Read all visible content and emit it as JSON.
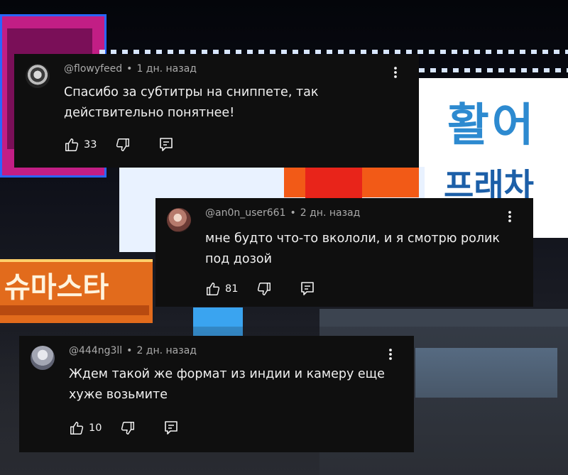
{
  "comments": [
    {
      "author": "@flowyfeed",
      "time": "1 дн. назад",
      "text": "Спасибо за субтитры на сниппете, так действительно понятнее!",
      "likes": "33"
    },
    {
      "author": "@an0n_user661",
      "time": "2 дн. назад",
      "text": "мне будто что-то вкололи, и я смотрю ролик под дозой",
      "likes": "81"
    },
    {
      "author": "@444ng3ll",
      "time": "2 дн. назад",
      "text": "Ждем такой же формат из индии и камеру еще хуже возьмите",
      "likes": "10"
    }
  ],
  "separator": "•",
  "icons": {
    "like": "thumbs-up-icon",
    "dislike": "thumbs-down-icon",
    "reply": "reply-icon",
    "menu": "more-vertical-icon"
  },
  "colors": {
    "card_bg": "#0f0f0f",
    "text": "#f1f1f1",
    "meta": "#aaaaaa"
  },
  "background": {
    "hangul_1": "활어",
    "hangul_2": "프래차",
    "hangul_3": "슈마스타"
  }
}
